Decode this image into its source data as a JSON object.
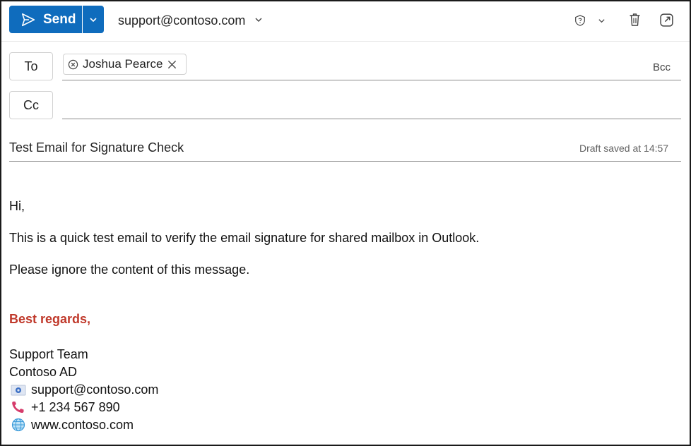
{
  "toolbar": {
    "send_label": "Send",
    "from_address": "support@contoso.com"
  },
  "recipients": {
    "to_label": "To",
    "cc_label": "Cc",
    "bcc_label": "Bcc",
    "to_chips": [
      {
        "name": "Joshua Pearce"
      }
    ]
  },
  "subject": {
    "value": "Test Email for Signature Check",
    "draft_status": "Draft saved at 14:57"
  },
  "message": {
    "greeting": "Hi,",
    "line1": "This is a quick test email to verify the email signature for shared mailbox in Outlook.",
    "line2": "Please ignore the content of this message."
  },
  "signature": {
    "closing": "Best regards,",
    "team": "Support Team",
    "company": "Contoso AD",
    "email": "support@contoso.com",
    "phone": "+1 234 567 890",
    "website": "www.contoso.com"
  },
  "icons": {
    "send": "send-icon",
    "split": "chevron-down-icon",
    "sensitivity": "shield-question-icon",
    "delete": "trash-icon",
    "popout": "popout-icon",
    "email": "email-card-icon",
    "phone": "phone-icon",
    "website": "globe-icon"
  },
  "colors": {
    "accent": "#0f6cbd",
    "closing": "#c0392b"
  }
}
